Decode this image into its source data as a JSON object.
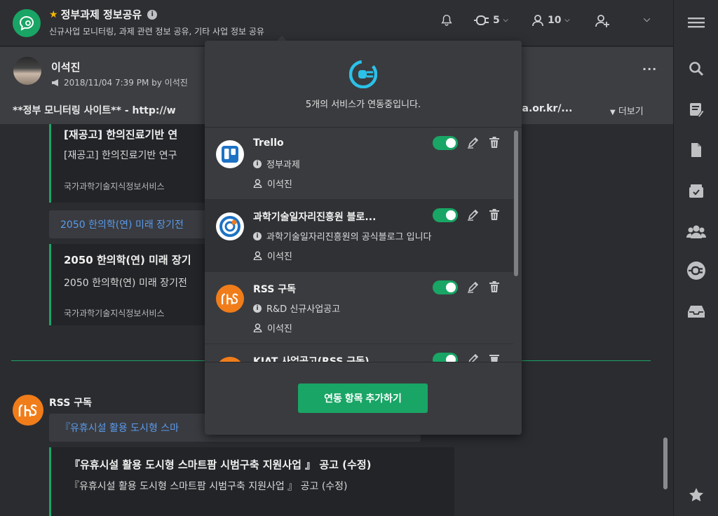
{
  "header": {
    "room_title": "정부과제 정보공유",
    "room_description": "신규사업 모니터링, 과제 관련 정보 공유, 기타 사업 정보 공유",
    "integrations_count": "5",
    "members_count": "10",
    "starred": true
  },
  "notice": {
    "author": "이석진",
    "meta": "2018/11/04 7:39 PM by 이석진",
    "text_left": "**정부 모니터링 사이트** - http://w",
    "text_right": "ea.or.kr/...",
    "more_label": "더보기",
    "menu_label": "···"
  },
  "feed": {
    "card1": {
      "title": "[재공고] 한의진료기반 연",
      "desc": "[재공고] 한의진료기반 연구",
      "source": "국가과학기술지식정보서비스"
    },
    "link1": "2050 한의학(연) 미래 장기전",
    "card2": {
      "title": "2050 한의학(연) 미래 장기",
      "desc": "2050 한의학(연) 미래 장기전",
      "source": "국가과학기술지식정보서비스"
    },
    "rss_name": "RSS 구독",
    "link2": "『유휴시설 활용 도시형 스마",
    "card3": {
      "title": "『유휴시설 활용 도시형 스마트팜 시범구축 지원사업 』 공고 (수정)",
      "desc": "『유휴시설 활용 도시형 스마트팜 시범구축 지원사업 』 공고 (수정)"
    }
  },
  "popup": {
    "status_text": "5개의 서비스가 연동중입니다.",
    "services": [
      {
        "name": "Trello",
        "topic": "정부과제",
        "owner": "이석진",
        "enabled": true,
        "icon": "trello-icon"
      },
      {
        "name": "과학기술일자리진흥원 블로...",
        "topic": "과학기술일자리진흥원의 공식블로그 입니다",
        "owner": "이석진",
        "enabled": true,
        "icon": "blog-logo-icon"
      },
      {
        "name": "RSS 구독",
        "topic": "R&D 신규사업공고",
        "owner": "이석진",
        "enabled": true,
        "icon": "rss-icon"
      },
      {
        "name": "KIAT 사업공고(RSS 구독)",
        "topic": "",
        "owner": "",
        "enabled": true,
        "icon": "rss-icon"
      }
    ],
    "add_button": "연동 항목 추가하기"
  },
  "colors": {
    "accent": "#19a565",
    "rss_orange": "#f07d1a",
    "link_blue": "#5a9bea",
    "trello_blue": "#1d72c4"
  }
}
